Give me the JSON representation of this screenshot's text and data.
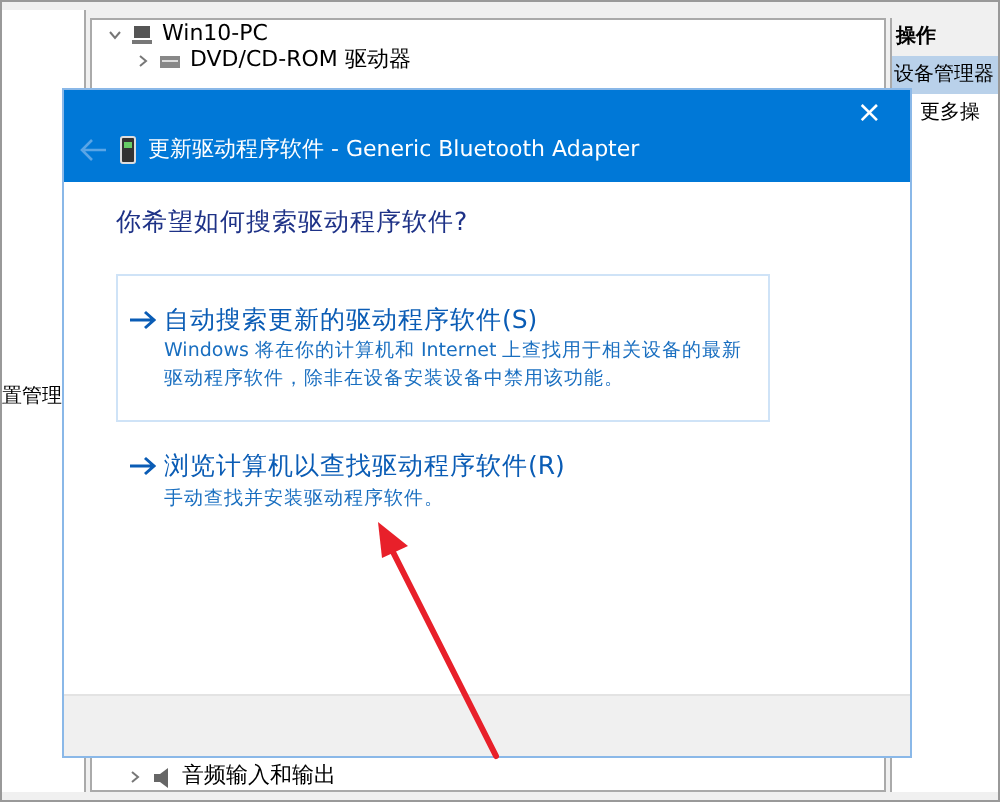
{
  "left_pane": {
    "label": "置管理"
  },
  "tree": {
    "items": [
      {
        "label": "Win10-PC",
        "expanded": true
      },
      {
        "label": "DVD/CD-ROM 驱动器",
        "expanded": false
      }
    ],
    "bottom_item": {
      "label": "音频输入和输出",
      "expanded": false
    }
  },
  "actions": {
    "header": "操作",
    "items": [
      {
        "label": "设备管理器",
        "selected": true
      },
      {
        "label": "更多操",
        "selected": false
      }
    ]
  },
  "dialog": {
    "title": "更新驱动程序软件 - Generic Bluetooth Adapter",
    "close": "×",
    "back_enabled": false,
    "question": "你希望如何搜索驱动程序软件?",
    "options": [
      {
        "title": "自动搜索更新的驱动程序软件(S)",
        "description": "Windows 将在你的计算机和 Internet 上查找用于相关设备的最新驱动程序软件，除非在设备安装设备中禁用该功能。",
        "hover": true
      },
      {
        "title": "浏览计算机以查找驱动程序软件(R)",
        "description": "手动查找并安装驱动程序软件。",
        "hover": false
      }
    ]
  },
  "annotation": {
    "kind": "arrow"
  }
}
